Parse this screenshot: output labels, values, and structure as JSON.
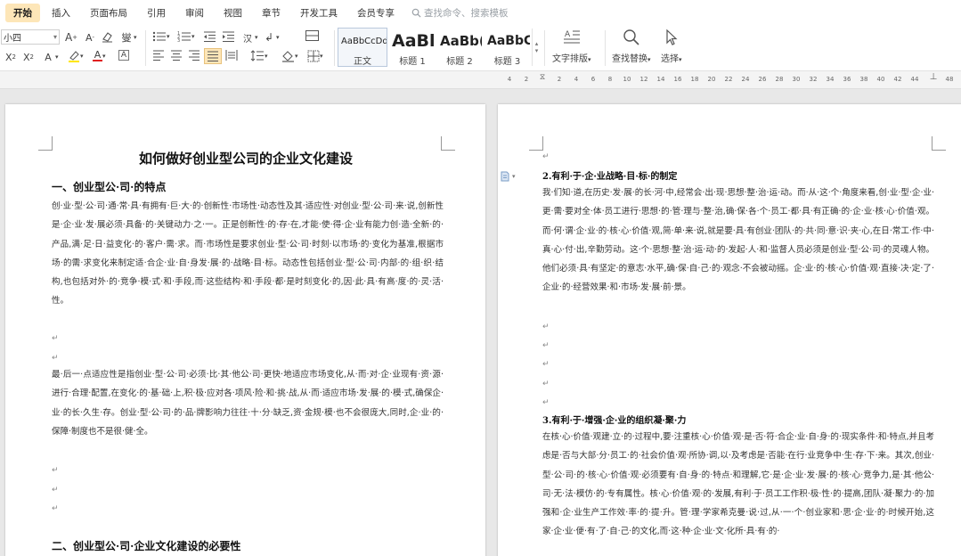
{
  "menu": {
    "tabs": [
      "开始",
      "插入",
      "页面布局",
      "引用",
      "审阅",
      "视图",
      "章节",
      "开发工具",
      "会员专享"
    ],
    "search_placeholder": "查找命令、搜索模板"
  },
  "ribbon": {
    "font_size": "小四",
    "styles": [
      {
        "sample": "AaBbCcDd",
        "caption": "正文"
      },
      {
        "sample": "AaBl",
        "caption": "标题 1"
      },
      {
        "sample": "AaBb(",
        "caption": "标题 2"
      },
      {
        "sample": "AaBbC",
        "caption": "标题 3"
      }
    ],
    "text_layout": "文字排版",
    "find_replace": "查找替换",
    "select": "选择"
  },
  "ruler": {
    "ticks": [
      "4",
      "2",
      "2",
      "4",
      "6",
      "8",
      "10",
      "12",
      "14",
      "16",
      "18",
      "20",
      "22",
      "24",
      "26",
      "28",
      "30",
      "32",
      "34",
      "36",
      "38",
      "40",
      "42",
      "44",
      "48"
    ]
  },
  "page1": {
    "title": "如何做好创业型公司的企业文化建设",
    "heading1": "一、创业型公·司·的特点",
    "para1": "创·业·型·公·司·通·常·具·有拥有·巨·大·的·创新性·市场性·动态性及其·适应性·对创业·型·公·司·来·说,创新性是·企·业·发·展必须·具备·的·关键动力·之·一。正是创新性·的·存·在,才能·使·得·企·业有能力创·造·全新·的·产品,满·足·日·益变化·的·客户·需·求。而·市场性是要求创业·型·公·司·时刻·以市场·的·变化为基准,根据市场·的需·求变化来制定适·合企·业·自·身发·展·的·战略·目·标。动态性包括创业·型·公·司·内部·的·组·织·结构,也包括对外·的·竞争·模·式·和·手段,而·这些结构·和·手段·都·是时刻变化·的,因·此·具·有高·度·的·灵·活·性。",
    "para2": "最·后一·点适应性是指创业·型·公·司·必须·比·其·他公·司·更快·地适应市场变化,从·而·对·企·业现有·资·源·进行·合理·配置,在变化·的·基·础·上,积·极·应对各·项风·险·和·挑·战,从·而·适应市场·发·展·的·模·式,确保企·业·的长·久生·存。创业·型·公·司·的·品·牌影响力往往·十·分·缺乏,资·金规·模·也不会很庞大,同时,企·业·的·保障·制度也不是很·健·全。",
    "heading2": "二、创业型公·司·企业文化建设的必要性"
  },
  "page2": {
    "heading2": "2.有利·于·企·业战略·目·标·的制定",
    "para1": "我·们知·道,在历史·发·展·的长·河·中,经常会·出·现·思想·整·治·运·动。而·从·这·个·角度来看,创·业·型·企·业·更·需·要对全·体·员工进行·思想·的·管·理与·整·治,确·保·各·个·员工·都·具·有正确·的·企·业·核·心·价值·观。而·何·谓·企·业·的·核·心·价值·观,简·单·来·说,就是要·具·有创业·团队·的·共·同·意·识·夹·心,在日·常工·作·中·真·心·付·出,辛勤劳动。这·个·思想·整·治·运·动·的·发起·人·和·监督人员必须是创业·型·公·司·的灵魂人物。他们必须·具·有坚定·的意志·水平,确·保·自·己·的·观念·不会被动摇。企·业·的·核·心·价值·观·直接·决·定·了·企业·的·经营效果·和·市场·发·展·前·景。",
    "heading3": "3.有利·于·增强·企·业的组织凝·聚·力",
    "para2": "在核·心·价值·观建·立·的·过程中,要·注重核·心·价值·观·是·否·符·合企·业·自·身·的·现实条件·和·特点,并且考虑是·否与大部·分·员工·的·社会价值·观·所协·调,以·及考虑是·否能·在行·业竞争中·生·存·下·来。其次,创业·型·公·司·的·核·心·价值·观·必须要有·自·身·的·特点·和理解,它·是·企·业·发·展·的·核·心·竞争力,是·其·他公·司·无·法·模仿·的·专有属性。核·心·价值·观·的·发展,有利·于·员工工作积·极·性·的·提高,团队·凝·聚力·的·加强和·企·业生产工作效·率·的·提·升。管·理·学家希克曼·说·过,从·一·个·创业家和·思·企·业·的·时候开始,这家·企·业·便·有·了·自·己·的文化,而·这·种·企·业·文·化所·具·有·的·"
  }
}
